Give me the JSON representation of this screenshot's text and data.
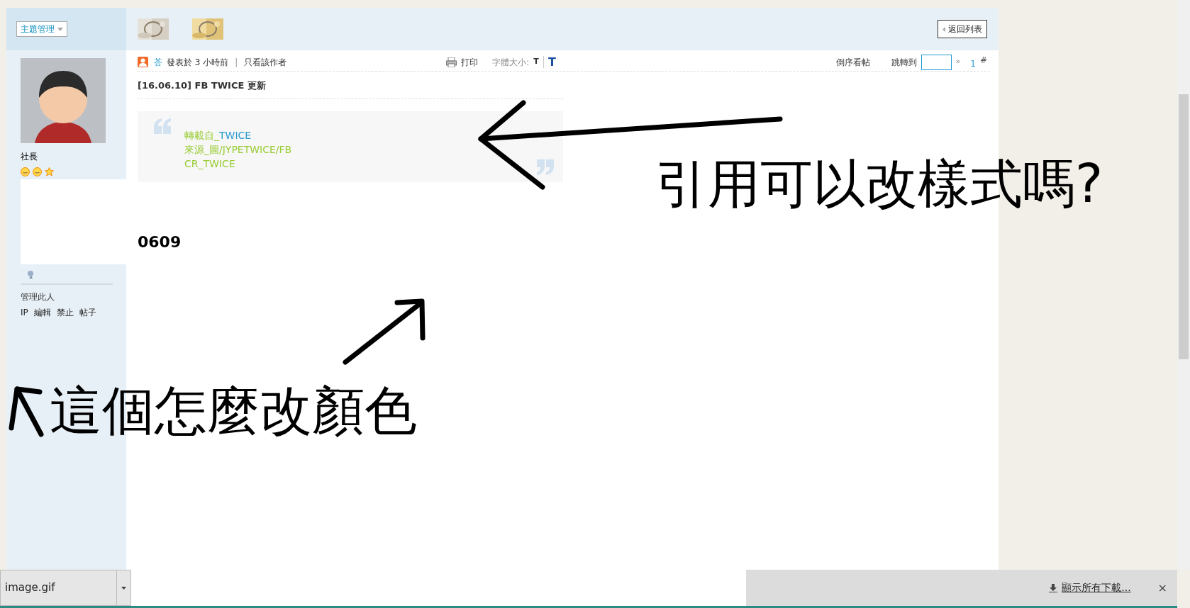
{
  "header": {
    "manage_menu": "主題管理",
    "back_button": "返回列表"
  },
  "sidebar": {
    "rank": "社長",
    "admin_title": "管理此人",
    "admin_links": [
      "IP",
      "編輯",
      "禁止",
      "帖子"
    ]
  },
  "post_bar": {
    "author": "荅",
    "posted": "發表於 3 小時前",
    "separator": "|",
    "only_author": "只看該作者",
    "print": "打印",
    "font_size_label": "字體大小:",
    "font_small": "T",
    "font_large": "T",
    "reverse": "倒序看帖",
    "jump_label": "跳轉到",
    "jump_go": "»",
    "floor": "1",
    "floor_mark": "#"
  },
  "post": {
    "title": "[16.06.10] FB TWICE 更新",
    "quote_lines": [
      [
        {
          "kind": "plain",
          "text": "轉載自_"
        },
        {
          "kind": "link",
          "text": "TWICE"
        }
      ],
      [
        {
          "kind": "plain",
          "text": "來源_圖/JYPETWICE/FB"
        }
      ],
      [
        {
          "kind": "plain",
          "text": "CR_TWICE"
        }
      ]
    ],
    "body_heading": "0609"
  },
  "annotations": [
    "引用可以改樣式嗎?",
    "這個怎麼改顏色"
  ],
  "downloads": {
    "file": "image.gif",
    "show_all": "顯示所有下載...",
    "close": "×"
  }
}
